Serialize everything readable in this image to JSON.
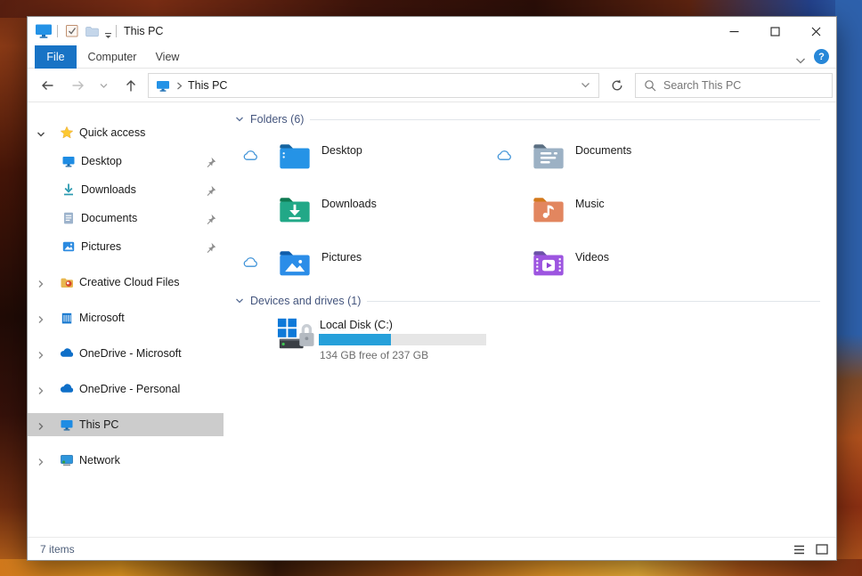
{
  "titlebar": {
    "title": "This PC"
  },
  "ribbon": {
    "tabs": [
      {
        "label": "File",
        "active": true
      },
      {
        "label": "Computer",
        "active": false
      },
      {
        "label": "View",
        "active": false
      }
    ]
  },
  "navbar": {
    "breadcrumb_root": "This PC",
    "search_placeholder": "Search This PC"
  },
  "sidebar": {
    "items": [
      {
        "label": "Quick access"
      },
      {
        "label": "Desktop",
        "pinned": true
      },
      {
        "label": "Downloads",
        "pinned": true
      },
      {
        "label": "Documents",
        "pinned": true
      },
      {
        "label": "Pictures",
        "pinned": true
      },
      {
        "label": "Creative Cloud Files"
      },
      {
        "label": "Microsoft"
      },
      {
        "label": "OneDrive - Microsoft"
      },
      {
        "label": "OneDrive - Personal"
      },
      {
        "label": "This PC",
        "selected": true
      },
      {
        "label": "Network"
      }
    ]
  },
  "content": {
    "groups": [
      {
        "label": "Folders (6)"
      },
      {
        "label": "Devices and drives (1)"
      }
    ],
    "folders": [
      {
        "label": "Desktop",
        "cloud": true
      },
      {
        "label": "Documents",
        "cloud": true
      },
      {
        "label": "Downloads",
        "cloud": false
      },
      {
        "label": "Music",
        "cloud": false
      },
      {
        "label": "Pictures",
        "cloud": true
      },
      {
        "label": "Videos",
        "cloud": false
      }
    ],
    "drive": {
      "label": "Local Disk (C:)",
      "free_text": "134 GB free of 237 GB",
      "used_percent": 43
    }
  },
  "statusbar": {
    "items_count": "7 items"
  },
  "colors": {
    "accent_blue": "#1873c5",
    "disk_bar_fill": "#26a0da",
    "selection_gray": "#cccccc"
  }
}
